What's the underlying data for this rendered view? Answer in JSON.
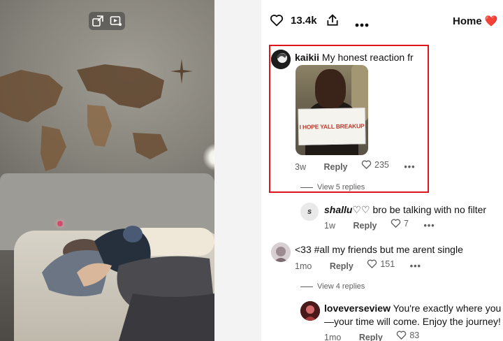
{
  "topbar": {
    "like_count": "13.4k",
    "board_label": "Home",
    "board_icon": "heart"
  },
  "comments": [
    {
      "username": "kaikii",
      "text": "My honest reaction fr",
      "image_sign_text": "I HOPE YALL BREAKUP",
      "age": "3w",
      "reply_label": "Reply",
      "likes": "235",
      "replies_toggle": "View 5 replies",
      "highlighted": true
    },
    {
      "username": "shallu♡♡",
      "avatar_letter": "s",
      "text": "bro be talking with no filter",
      "age": "1w",
      "reply_label": "Reply",
      "likes": "7"
    },
    {
      "username": "",
      "text": "<33 #all my friends but me arent single",
      "age": "1mo",
      "reply_label": "Reply",
      "likes": "151",
      "replies_toggle": "View 4 replies"
    },
    {
      "username": "loveverseview",
      "text": "You're exactly where you ne",
      "text_line2": "—your time will come. Enjoy the journey!",
      "age": "1mo",
      "reply_label": "Reply",
      "likes": "83"
    }
  ],
  "colors": {
    "highlight_border": "#e0151c",
    "heart_red": "#e60023",
    "meta_grey": "#5f5f5f"
  }
}
